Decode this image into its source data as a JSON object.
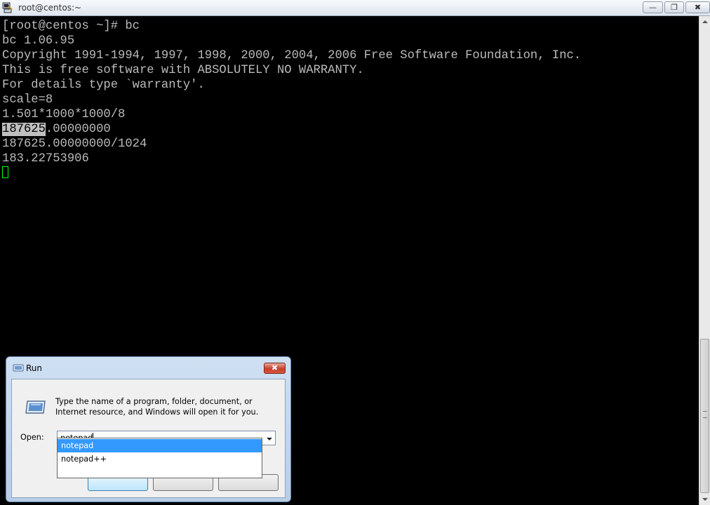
{
  "window": {
    "title": "root@centos:~",
    "min_label": "—",
    "max_label": "❐",
    "close_label": "✖"
  },
  "terminal": {
    "lines": [
      "[root@centos ~]# bc",
      "bc 1.06.95",
      "Copyright 1991-1994, 1997, 1998, 2000, 2004, 2006 Free Software Foundation, Inc.",
      "This is free software with ABSOLUTELY NO WARRANTY.",
      "For details type `warranty'.",
      "scale=8",
      "1.501*1000*1000/8",
      "",
      "187625.00000000/1024",
      "183.22753906"
    ],
    "selected_text": "187625",
    "selected_rest": ".00000000"
  },
  "run_dialog": {
    "title": "Run",
    "close_label": "✖",
    "description": "Type the name of a program, folder, document, or Internet resource, and Windows will open it for you.",
    "open_label": "Open:",
    "open_value": "notepad",
    "autocomplete": [
      "notepad",
      "notepad++"
    ],
    "selected_autocomplete": "notepad"
  }
}
